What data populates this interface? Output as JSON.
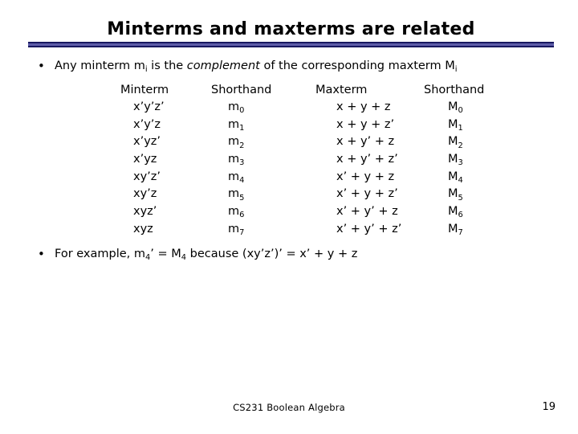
{
  "slide": {
    "title": "Minterms and maxterms are related",
    "accent_dark": "#181860",
    "accent_light": "#5d5ca8",
    "background": "#ffffff",
    "text_color": "#000000"
  },
  "bullets": {
    "glyph": "•",
    "first": {
      "pre": "Any minterm m",
      "sub1": "i",
      "mid": " is the ",
      "italic": "complement",
      "post": " of the corresponding maxterm M",
      "sub2": "i"
    },
    "second": {
      "pre": "For example, m",
      "sub1": "4",
      "mid": "’ = M",
      "sub2": "4",
      "post": " because (xy’z’)’ = x’ + y + z"
    }
  },
  "table": {
    "headers": [
      "Minterm",
      "Shorthand",
      "Maxterm",
      "Shorthand"
    ],
    "rows": [
      {
        "minterm": "x’y’z’",
        "short_m": "m",
        "short_m_sub": "0",
        "maxterm": "x + y + z",
        "short_M": "M",
        "short_M_sub": "0"
      },
      {
        "minterm": "x’y’z",
        "short_m": "m",
        "short_m_sub": "1",
        "maxterm": "x + y + z’",
        "short_M": "M",
        "short_M_sub": "1"
      },
      {
        "minterm": "x’yz’",
        "short_m": "m",
        "short_m_sub": "2",
        "maxterm": "x + y’ + z",
        "short_M": "M",
        "short_M_sub": "2"
      },
      {
        "minterm": "x’yz",
        "short_m": "m",
        "short_m_sub": "3",
        "maxterm": "x + y’ + z’",
        "short_M": "M",
        "short_M_sub": "3"
      },
      {
        "minterm": "xy’z’",
        "short_m": "m",
        "short_m_sub": "4",
        "maxterm": "x’ + y + z",
        "short_M": "M",
        "short_M_sub": "4"
      },
      {
        "minterm": "xy’z",
        "short_m": "m",
        "short_m_sub": "5",
        "maxterm": "x’ + y + z’",
        "short_M": "M",
        "short_M_sub": "5"
      },
      {
        "minterm": "xyz’",
        "short_m": "m",
        "short_m_sub": "6",
        "maxterm": "x’ + y’ + z",
        "short_M": "M",
        "short_M_sub": "6"
      },
      {
        "minterm": "xyz",
        "short_m": "m",
        "short_m_sub": "7",
        "maxterm": "x’ + y’ + z’",
        "short_M": "M",
        "short_M_sub": "7"
      }
    ]
  },
  "footer": {
    "course": "CS231 Boolean Algebra",
    "page_number": "19"
  }
}
